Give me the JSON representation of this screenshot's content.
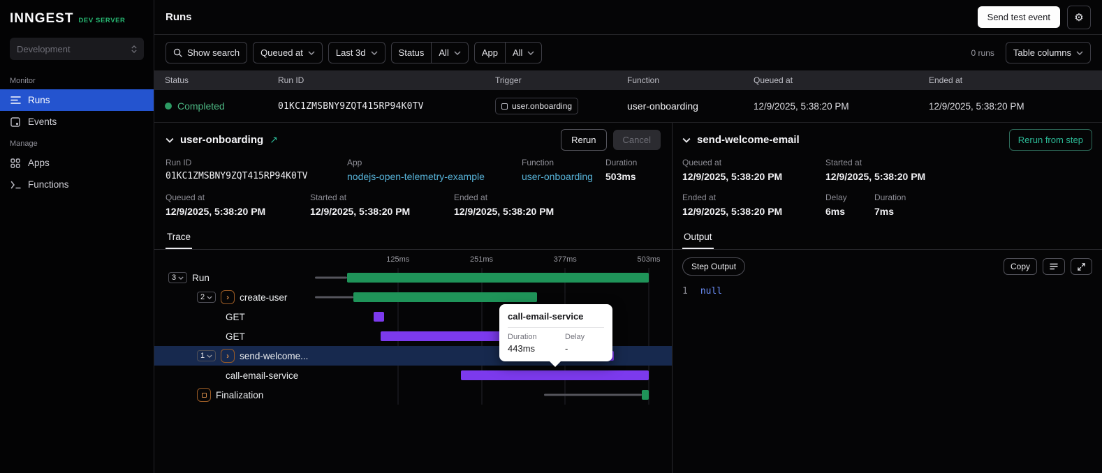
{
  "colors": {
    "accent_blue": "#2454cf",
    "success_green": "#2c9b63",
    "bar_green": "#1f9459",
    "bar_purple": "#7c3aed",
    "link_blue": "#57b3d8",
    "teal": "#2cb996",
    "selected_row": "#17294e"
  },
  "sidebar": {
    "logo": "INNGEST",
    "badge": "DEV SERVER",
    "environment": "Development",
    "monitor_label": "Monitor",
    "manage_label": "Manage",
    "runs": "Runs",
    "events": "Events",
    "apps": "Apps",
    "functions": "Functions"
  },
  "topbar": {
    "title": "Runs",
    "send_test_event": "Send test event"
  },
  "filters": {
    "show_search": "Show search",
    "queued_at": "Queued at",
    "time_range": "Last 3d",
    "status_label": "Status",
    "status_value": "All",
    "app_label": "App",
    "app_value": "All",
    "runs_count": "0 runs",
    "table_columns": "Table columns"
  },
  "runs_table": {
    "headers": [
      "Status",
      "Run ID",
      "Trigger",
      "Function",
      "Queued at",
      "Ended at"
    ],
    "row": {
      "status": "Completed",
      "run_id": "01KC1ZMSBNY9ZQT415RP94K0TV",
      "trigger": "user.onboarding",
      "function": "user-onboarding",
      "queued_at": "12/9/2025, 5:38:20 PM",
      "ended_at": "12/9/2025, 5:38:20 PM"
    }
  },
  "run_details": {
    "title": "user-onboarding",
    "rerun_button": "Rerun",
    "cancel_button": "Cancel",
    "run_id_label": "Run ID",
    "run_id": "01KC1ZMSBNY9ZQT415RP94K0TV",
    "app_label": "App",
    "app": "nodejs-open-telemetry-example",
    "function_label": "Function",
    "function": "user-onboarding",
    "duration_label": "Duration",
    "duration": "503ms",
    "queued_at_label": "Queued at",
    "queued_at": "12/9/2025, 5:38:20 PM",
    "started_at_label": "Started at",
    "started_at": "12/9/2025, 5:38:20 PM",
    "ended_at_label": "Ended at",
    "ended_at": "12/9/2025, 5:38:20 PM",
    "trace_tab": "Trace"
  },
  "trace": {
    "axis_max_ms": 503,
    "axis_ticks": [
      "125ms",
      "251ms",
      "377ms",
      "503ms"
    ],
    "rows": [
      {
        "name": "Run",
        "counter": "3",
        "indent": 0,
        "segments": [
          {
            "kind": "line",
            "start": 0,
            "end": 48
          },
          {
            "kind": "bar",
            "color": "green",
            "start": 48,
            "end": 503
          }
        ]
      },
      {
        "name": "create-user",
        "counter": "2",
        "icon": "step",
        "indent": 1,
        "segments": [
          {
            "kind": "line",
            "start": 0,
            "end": 58
          },
          {
            "kind": "bar",
            "color": "green",
            "start": 58,
            "end": 335
          }
        ]
      },
      {
        "name": "GET",
        "indent": 2,
        "segments": [
          {
            "kind": "bar",
            "color": "purple",
            "start": 88,
            "end": 104
          }
        ]
      },
      {
        "name": "GET",
        "indent": 2,
        "segments": [
          {
            "kind": "bar",
            "color": "purple",
            "start": 99,
            "end": 310
          }
        ]
      },
      {
        "name": "send-welcome...",
        "counter": "1",
        "icon": "step",
        "indent": 1,
        "selected": true,
        "segments": [
          {
            "kind": "bar",
            "color": "purple",
            "start": 436,
            "end": 450
          }
        ]
      },
      {
        "name": "call-email-service",
        "indent": 2,
        "segments": [
          {
            "kind": "bar",
            "color": "purple",
            "start": 220,
            "end": 503
          }
        ]
      },
      {
        "name": "Finalization",
        "icon": "finalization",
        "indent": 1,
        "segments": [
          {
            "kind": "line",
            "start": 345,
            "end": 492
          },
          {
            "kind": "bar",
            "color": "green",
            "start": 492,
            "end": 503
          }
        ]
      }
    ],
    "tooltip": {
      "title": "call-email-service",
      "duration_label": "Duration",
      "delay_label": "Delay",
      "duration": "443ms",
      "delay": "-"
    }
  },
  "step_details": {
    "title": "send-welcome-email",
    "rerun_from_step": "Rerun from step",
    "queued_at_label": "Queued at",
    "queued_at": "12/9/2025, 5:38:20 PM",
    "started_at_label": "Started at",
    "started_at": "12/9/2025, 5:38:20 PM",
    "ended_at_label": "Ended at",
    "ended_at": "12/9/2025, 5:38:20 PM",
    "delay_label": "Delay",
    "delay": "6ms",
    "duration_label": "Duration",
    "duration": "7ms",
    "output_tab": "Output"
  },
  "output": {
    "badge": "Step Output",
    "copy_button": "Copy",
    "line_number": "1",
    "code": "null"
  }
}
